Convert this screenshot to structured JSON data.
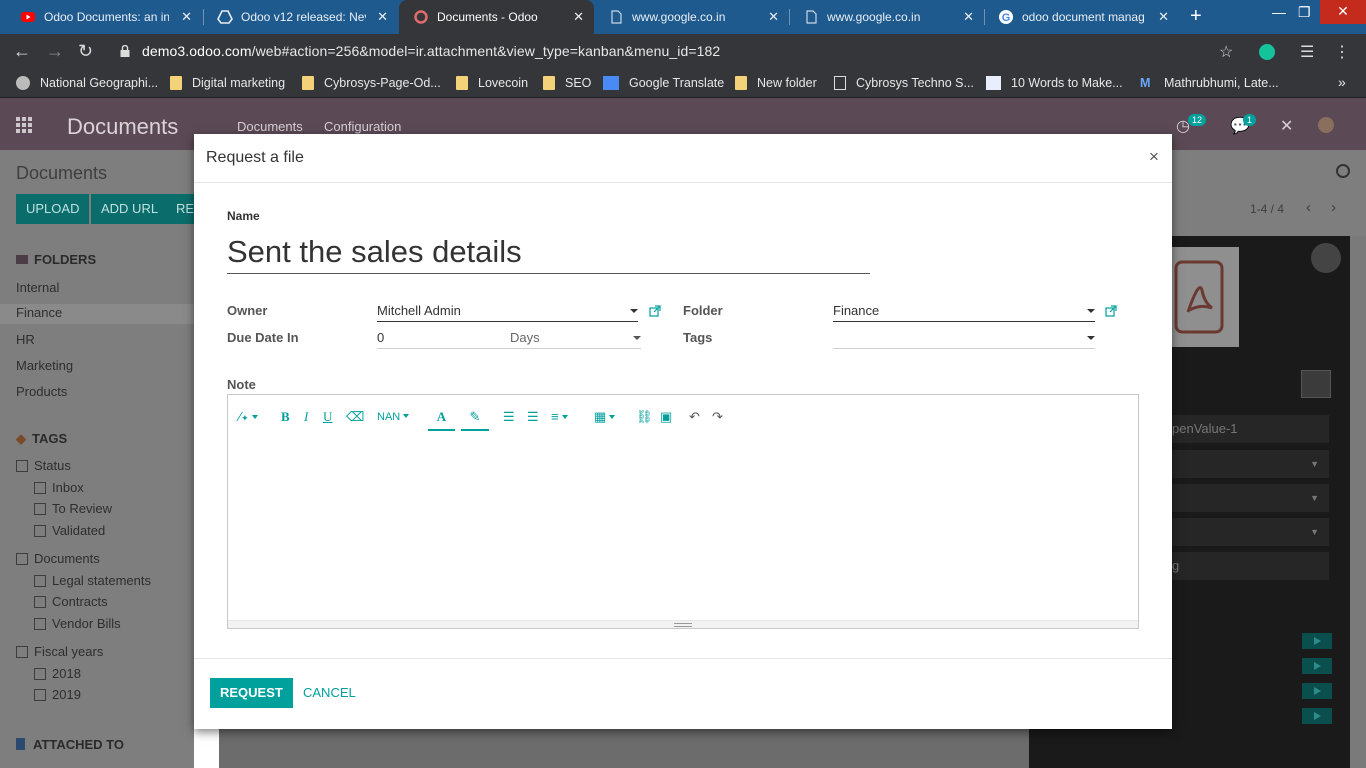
{
  "browser": {
    "tabs": [
      {
        "title": "Odoo Documents: an in",
        "icon": "youtube-icon"
      },
      {
        "title": "Odoo v12 released: Nev",
        "icon": "google-drive-icon"
      },
      {
        "title": "Documents - Odoo",
        "icon": "odoo-icon"
      },
      {
        "title": "www.google.co.in",
        "icon": "page-icon"
      },
      {
        "title": "www.google.co.in",
        "icon": "page-icon"
      },
      {
        "title": "odoo document manag",
        "icon": "google-icon"
      }
    ],
    "url_host": "demo3.odoo.com",
    "url_path": "/web#action=256&model=ir.attachment&view_type=kanban&menu_id=182",
    "bookmarks": [
      "National Geographi...",
      "Digital marketing",
      "Cybrosys-Page-Od...",
      "Lovecoin",
      "SEO",
      "Google Translate",
      "New folder",
      "Cybrosys Techno S...",
      "10 Words to Make...",
      "Mathrubhumi, Late..."
    ],
    "colors": {
      "tab_bar": "#1f5a8f",
      "chrome_dark": "#35363a"
    }
  },
  "odoo": {
    "app_title": "Documents",
    "menus": [
      "Documents",
      "Configuration"
    ],
    "activity_count": "12",
    "message_count": "1",
    "breadcrumb": "Documents",
    "buttons": {
      "upload": "UPLOAD",
      "add_url": "ADD URL",
      "request": "RE"
    },
    "pager": "1-4 / 4",
    "right_panel_field": "penValue-1",
    "right_panel_tag": "g",
    "colors": {
      "navbar": "#5b4a55",
      "primary": "#00a09d"
    }
  },
  "sidebar": {
    "folders_heading": "FOLDERS",
    "folders": [
      "Internal",
      "Finance",
      "HR",
      "Marketing",
      "Products"
    ],
    "tags_heading": "TAGS",
    "status_label": "Status",
    "status_items": [
      "Inbox",
      "To Review",
      "Validated"
    ],
    "documents_label": "Documents",
    "documents_items": [
      "Legal statements",
      "Contracts",
      "Vendor Bills"
    ],
    "fiscal_label": "Fiscal years",
    "fiscal_items": [
      "2018",
      "2019"
    ],
    "attached_heading": "ATTACHED TO"
  },
  "modal": {
    "title": "Request a file",
    "close_glyph": "×",
    "name_label": "Name",
    "name_value": "Sent the sales details",
    "owner_label": "Owner",
    "owner_value": "Mitchell Admin",
    "due_label": "Due Date In",
    "due_value": "0",
    "due_unit": "Days",
    "folder_label": "Folder",
    "folder_value": "Finance",
    "tags_label": "Tags",
    "tags_value": "",
    "note_label": "Note",
    "editor": {
      "font_size": "NAN",
      "color_letter": "A",
      "bold": "B",
      "italic": "I",
      "underline": "U"
    },
    "request_button": "REQUEST",
    "cancel_button": "CANCEL"
  }
}
